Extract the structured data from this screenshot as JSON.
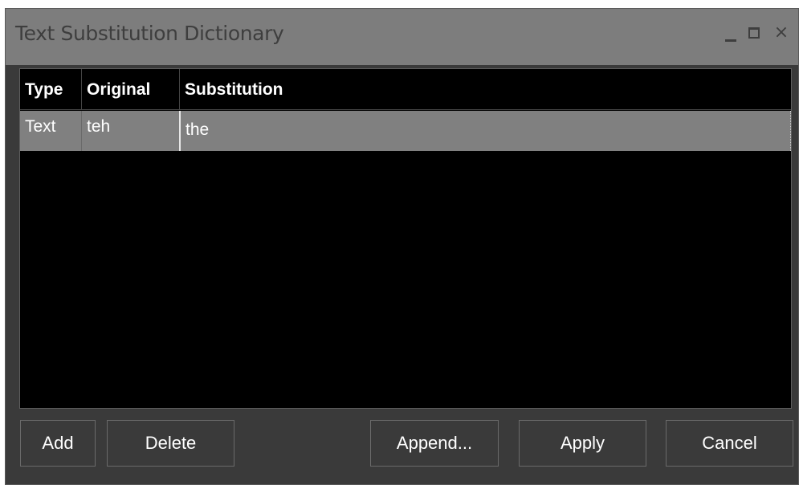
{
  "window": {
    "title": "Text Substitution Dictionary",
    "controls": {
      "minimize": "_",
      "maximize": "□",
      "close": "×"
    }
  },
  "table": {
    "columns": [
      "Type",
      "Original",
      "Substitution"
    ],
    "rows": [
      {
        "type": "Text",
        "original": "teh",
        "substitution": "the"
      }
    ]
  },
  "buttons": {
    "add": "Add",
    "delete": "Delete",
    "append": "Append...",
    "apply": "Apply",
    "cancel": "Cancel"
  }
}
